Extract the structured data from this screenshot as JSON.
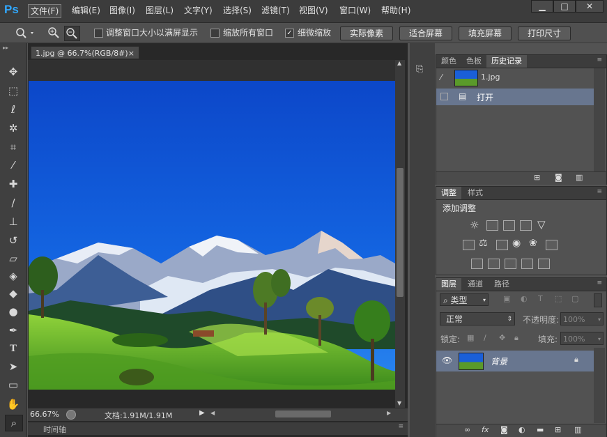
{
  "app": {
    "logo": "Ps"
  },
  "menu": [
    "文件(F)",
    "编辑(E)",
    "图像(I)",
    "图层(L)",
    "文字(Y)",
    "选择(S)",
    "滤镜(T)",
    "视图(V)",
    "窗口(W)",
    "帮助(H)"
  ],
  "window_buttons": {
    "minimize": "▁",
    "restore": "□",
    "close": "✕"
  },
  "options": {
    "fit_window_label": "调整窗口大小以满屏显示",
    "zoom_all_label": "缩放所有窗口",
    "scrubby_zoom_label": "细微缩放",
    "btn_actual": "实际像素",
    "btn_fit": "适合屏幕",
    "btn_fill": "填充屏幕",
    "btn_print": "打印尺寸"
  },
  "document": {
    "tab_title": "1.jpg @ 66.7%(RGB/8#)",
    "tab_close": "×"
  },
  "status": {
    "zoom": "66.67%",
    "doc_info": "文档:1.91M/1.91M"
  },
  "timeline": {
    "label": "时间轴"
  },
  "history_panel": {
    "tabs": [
      "颜色",
      "色板",
      "历史记录"
    ],
    "snapshot_name": "1.jpg",
    "step_open": "打开"
  },
  "adjust_panel": {
    "tabs": [
      "调整",
      "样式"
    ],
    "title": "添加调整"
  },
  "layers_panel": {
    "tabs": [
      "图层",
      "通道",
      "路径"
    ],
    "filter_kind": "类型",
    "blend_mode": "正常",
    "opacity_label": "不透明度:",
    "opacity_value": "100%",
    "lock_label": "锁定:",
    "fill_label": "填充:",
    "fill_value": "100%",
    "layer_name": "背景"
  },
  "colors": {
    "accent": "#31a8ff",
    "sky_top": "#0f4ecf",
    "sky_bottom": "#1a70e8",
    "grass": "#5aa72a"
  }
}
